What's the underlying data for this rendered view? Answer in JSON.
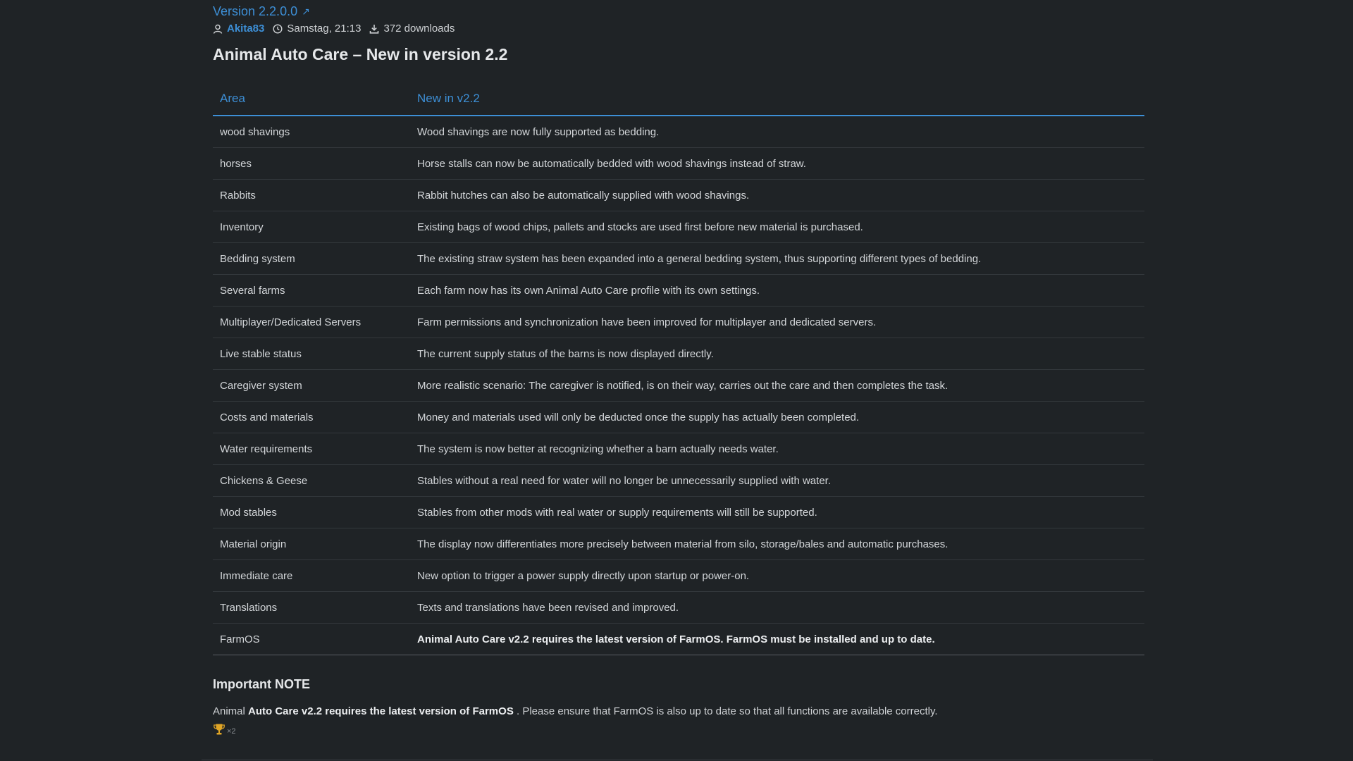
{
  "header": {
    "version_label": "Version 2.2.0.0",
    "version_link_icon": "external-link-icon",
    "author": "Akita83",
    "timestamp": "Samstag, 21:13",
    "downloads": "372 downloads"
  },
  "title": "Animal Auto Care – New in version 2.2",
  "table": {
    "headers": [
      "Area",
      "New in v2.2"
    ],
    "rows": [
      {
        "area": "wood shavings",
        "text": "Wood shavings are now fully supported as bedding."
      },
      {
        "area": "horses",
        "text": "Horse stalls can now be automatically bedded with wood shavings instead of straw."
      },
      {
        "area": "Rabbits",
        "text": "Rabbit hutches can also be automatically supplied with wood shavings."
      },
      {
        "area": "Inventory",
        "text": "Existing bags of wood chips, pallets and stocks are used first before new material is purchased."
      },
      {
        "area": "Bedding system",
        "text": "The existing straw system has been expanded into a general bedding system, thus supporting different types of bedding."
      },
      {
        "area": "Several farms",
        "text": "Each farm now has its own Animal Auto Care profile with its own settings."
      },
      {
        "area": "Multiplayer/Dedicated Servers",
        "text": "Farm permissions and synchronization have been improved for multiplayer and dedicated servers."
      },
      {
        "area": "Live stable status",
        "text": "The current supply status of the barns is now displayed directly."
      },
      {
        "area": "Caregiver system",
        "text": "More realistic scenario: The caregiver is notified, is on their way, carries out the care and then completes the task."
      },
      {
        "area": "Costs and materials",
        "text": "Money and materials used will only be deducted once the supply has actually been completed."
      },
      {
        "area": "Water requirements",
        "text": "The system is now better at recognizing whether a barn actually needs water."
      },
      {
        "area": "Chickens & Geese",
        "text": "Stables without a real need for water will no longer be unnecessarily supplied with water."
      },
      {
        "area": "Mod stables",
        "text": "Stables from other mods with real water or supply requirements will still be supported."
      },
      {
        "area": "Material origin",
        "text": "The display now differentiates more precisely between material from silo, storage/bales and automatic purchases."
      },
      {
        "area": "Immediate care",
        "text": "New option to trigger a power supply directly upon startup or power-on."
      },
      {
        "area": "Translations",
        "text": "Texts and translations have been revised and improved."
      },
      {
        "area": "FarmOS",
        "text": "Animal Auto Care v2.2 requires the latest version of FarmOS. FarmOS must be installed and up to date."
      }
    ]
  },
  "note": {
    "heading": "Important NOTE",
    "text_prefix": "Animal ",
    "text_bold": "Auto Care v2.2 requires the latest version of FarmOS",
    "text_suffix": " . Please ensure that FarmOS is also up to date so that all functions are available correctly."
  },
  "reaction": {
    "icon": "trophy-icon",
    "count": "×2"
  },
  "colors": {
    "background": "#1f2326",
    "accent": "#3d8fd6",
    "text": "#d6d8da"
  }
}
